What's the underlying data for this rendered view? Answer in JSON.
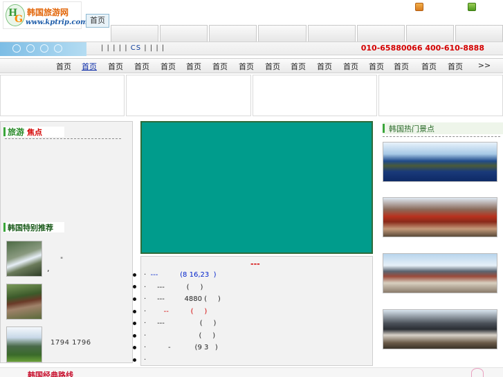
{
  "header": {
    "logo_text": "韩国旅游网",
    "logo_url": "www.kptrip.com",
    "first_tab": "首页"
  },
  "subbar": {
    "links_before": "|   |   |   |   |",
    "cs": "CS",
    "links_after": "|   |   |   |",
    "phones": "010-65880066 400-610-8888"
  },
  "nav": {
    "items": [
      "首页",
      "首页",
      "首页",
      "首页",
      "首页",
      "首页",
      "首页",
      "首页",
      "首页",
      "首页",
      "首页",
      "首页",
      "首页",
      "首页",
      "首页",
      "首页",
      "首页"
    ],
    "more": ">>"
  },
  "left": {
    "focus_title_1": "旅游",
    "focus_title_2": "焦点",
    "recommend_title": "韩国特别推荐",
    "mark1": "\"",
    "mark2": ",",
    "years": "1794  1796"
  },
  "news": {
    "head": "---",
    "rows": [
      {
        "pre": "·  ",
        "blue": "---          (8 16,23  )"
      },
      {
        "pre": "·     ---          (     )"
      },
      {
        "pre": "·     ---         4880 (     )"
      },
      {
        "pre": "·        ",
        "red": "--          (     )"
      },
      {
        "pre": "·     ---                (     )"
      },
      {
        "pre": "·                        (     )"
      },
      {
        "pre": "·          -           (9 3   )"
      },
      {
        "pre": "·"
      }
    ]
  },
  "right": {
    "title": "韩国热门景点"
  },
  "footer": {
    "text": "韩国经典路线"
  }
}
